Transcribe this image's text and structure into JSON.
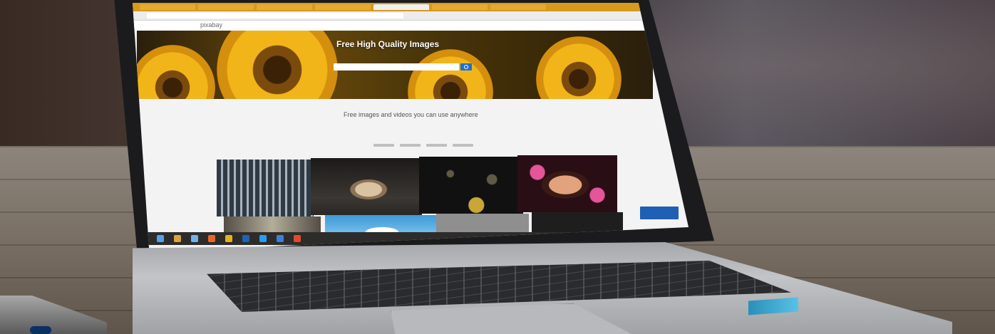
{
  "website": {
    "site_logo": "pixabay",
    "hero_title": "Free High Quality Images",
    "subtitle": "Free images and videos you can use anywhere"
  },
  "icons": [
    "laptop",
    "sunflower",
    "search-icon",
    "browser-tabs",
    "taskbar"
  ],
  "colors": {
    "browser_accent": "#d89a1b",
    "search_button": "#1f6fd1",
    "cta_button": "#1f5fb4"
  }
}
